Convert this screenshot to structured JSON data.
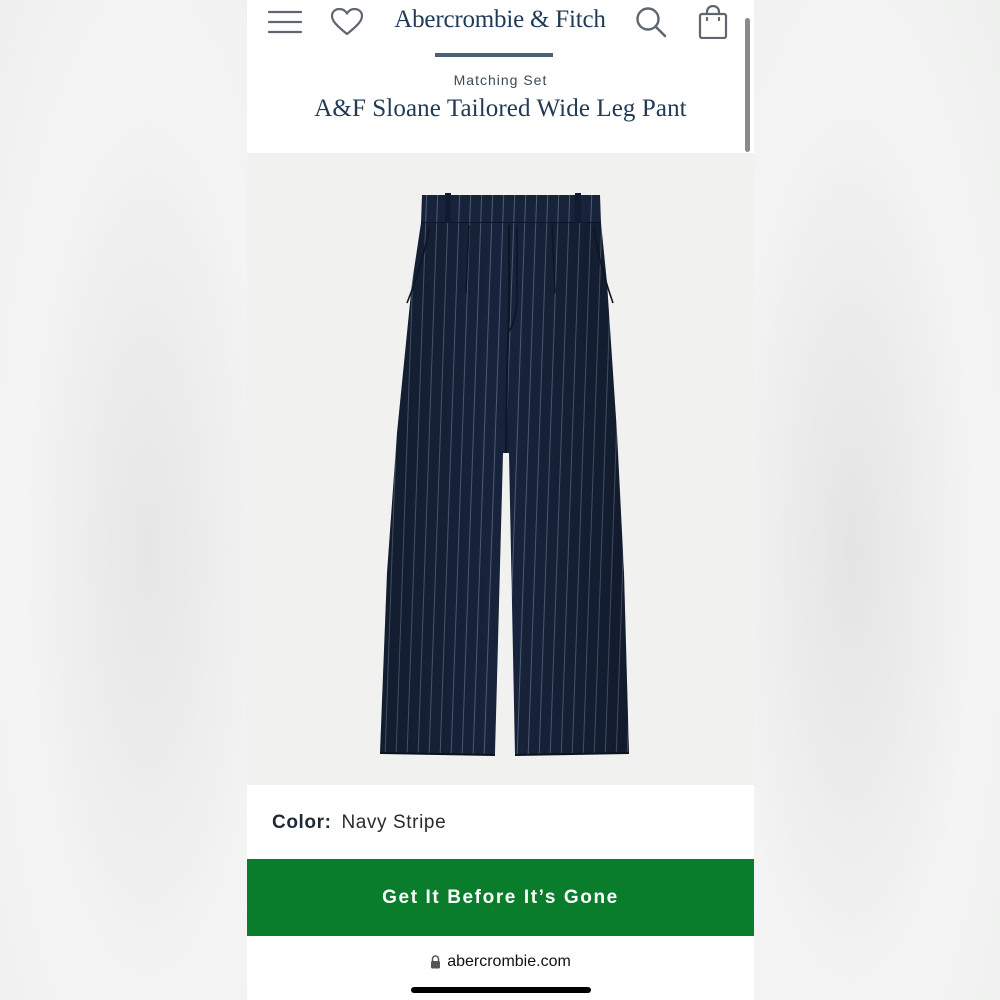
{
  "header": {
    "brand": "Abercrombie & Fitch",
    "eyebrow": "Matching Set",
    "title": "A&F Sloane Tailored Wide Leg Pant",
    "icons": [
      "menu-icon",
      "heart-icon",
      "search-icon",
      "shopping-bag-icon"
    ]
  },
  "product": {
    "image_alt": "Navy pinstripe wide leg trousers",
    "color_label": "Color:",
    "color_value": "Navy Stripe"
  },
  "cta": {
    "label": "Get It Before It’s Gone"
  },
  "browser": {
    "url": "abercrombie.com",
    "lock_icon": "lock-icon"
  },
  "colors": {
    "brand_text": "#1f3a57",
    "cta_bg": "#0a7d2d",
    "fabric": "#17233a"
  }
}
